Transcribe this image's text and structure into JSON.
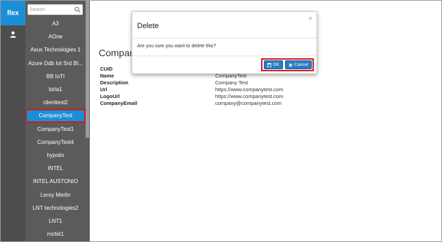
{
  "rail": {
    "logo": "flex",
    "user_icon": "user-icon"
  },
  "sidebar": {
    "search_placeholder": "Search",
    "items": [
      {
        "label": "A3"
      },
      {
        "label": "AOne"
      },
      {
        "label": "Asus Technologies 1"
      },
      {
        "label": "Azure Ddb Iot Srd Bl..."
      },
      {
        "label": "BB IoTt"
      },
      {
        "label": "birla1"
      },
      {
        "label": "clienttest2"
      },
      {
        "label": "CompanyTest",
        "selected": true
      },
      {
        "label": "CompanyTest1"
      },
      {
        "label": "CompanyTest4"
      },
      {
        "label": "hypotix"
      },
      {
        "label": "INTEL"
      },
      {
        "label": "INTEL AUSTONIO"
      },
      {
        "label": "Leroy Merlin"
      },
      {
        "label": "LNT technologies2"
      },
      {
        "label": "LNT1"
      },
      {
        "label": "mnfet1"
      }
    ]
  },
  "main": {
    "title": "Company",
    "fields": [
      {
        "label": "CUID",
        "value": ""
      },
      {
        "label": "Name",
        "value": "CompanyTest"
      },
      {
        "label": "Description",
        "value": "Company Test"
      },
      {
        "label": "Url",
        "value": "https://www.companytest.com"
      },
      {
        "label": "LogoUrl",
        "value": "https://www.companytest.com"
      },
      {
        "label": "CompanyEmail",
        "value": "company@companytest.com"
      }
    ]
  },
  "modal": {
    "title": "Delete",
    "close_glyph": "×",
    "message": "Are you sure you want to delete this?",
    "ok_label": "OK",
    "cancel_label": "Cancel"
  },
  "colors": {
    "accent": "#1a8fd6",
    "rail": "#4d4d4d",
    "list": "#5b5b5b",
    "button": "#2c7ac2",
    "highlight": "#d11a1a"
  }
}
